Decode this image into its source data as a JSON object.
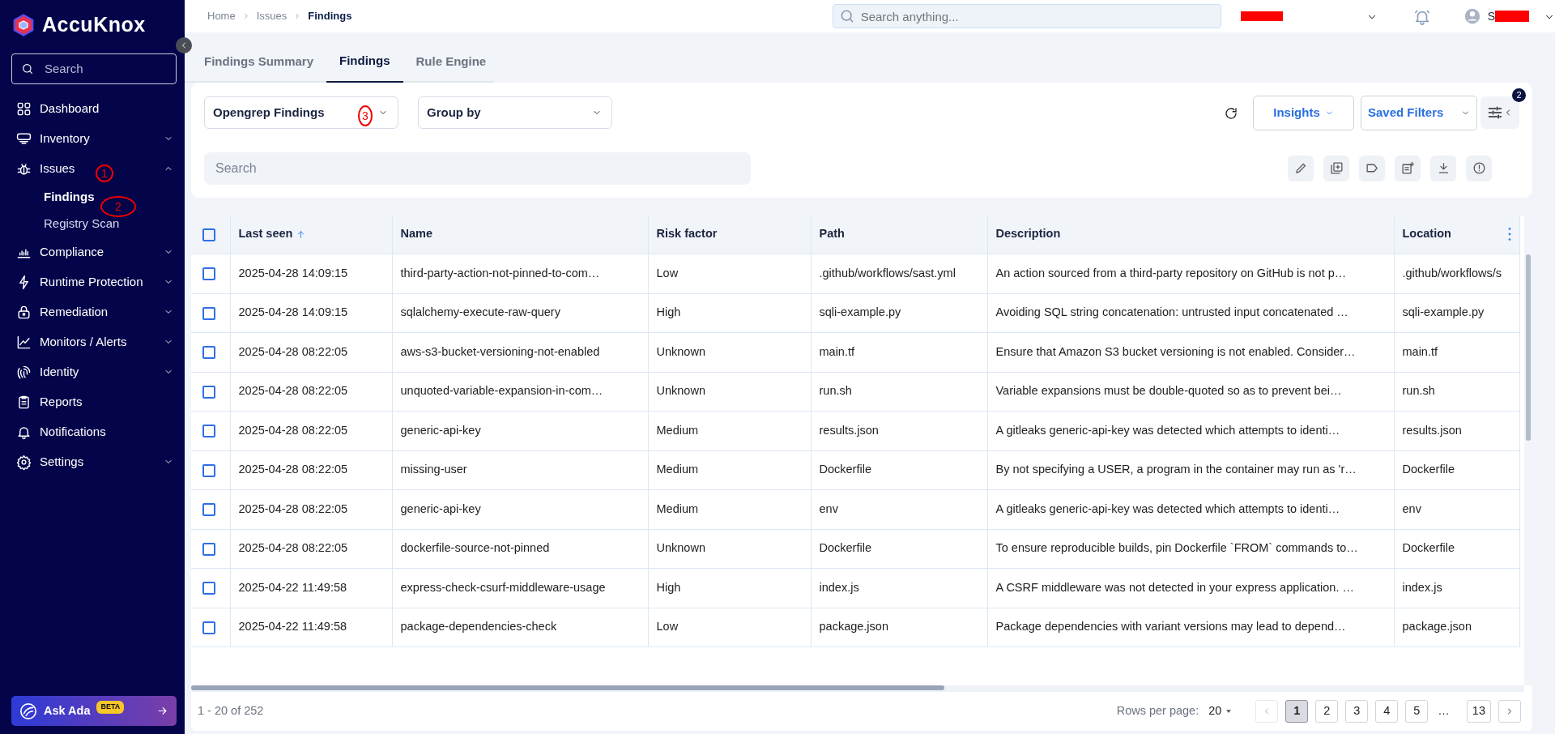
{
  "sidebar": {
    "brand": "AccuKnox",
    "search_placeholder": "Search",
    "items": [
      {
        "label": "Dashboard",
        "expandable": false
      },
      {
        "label": "Inventory",
        "expandable": true,
        "expanded": false
      },
      {
        "label": "Issues",
        "expandable": true,
        "expanded": true,
        "children": [
          {
            "label": "Findings",
            "selected": true
          },
          {
            "label": "Registry Scan",
            "selected": false
          }
        ]
      },
      {
        "label": "Compliance",
        "expandable": true,
        "expanded": false
      },
      {
        "label": "Runtime Protection",
        "expandable": true,
        "expanded": false
      },
      {
        "label": "Remediation",
        "expandable": true,
        "expanded": false
      },
      {
        "label": "Monitors / Alerts",
        "expandable": true,
        "expanded": false
      },
      {
        "label": "Identity",
        "expandable": true,
        "expanded": false
      },
      {
        "label": "Reports",
        "expandable": false
      },
      {
        "label": "Notifications",
        "expandable": false
      },
      {
        "label": "Settings",
        "expandable": true,
        "expanded": false
      }
    ],
    "assistant": {
      "label": "Ask Ada",
      "badge": "BETA"
    }
  },
  "breadcrumb": [
    "Home",
    "Issues",
    "Findings"
  ],
  "global_search": {
    "placeholder": "Search anything..."
  },
  "user": {
    "name_visible": "S"
  },
  "tabs": [
    {
      "label": "Findings Summary",
      "selected": false
    },
    {
      "label": "Findings",
      "selected": true
    },
    {
      "label": "Rule Engine",
      "selected": false
    }
  ],
  "filters": {
    "source": "Opengrep Findings",
    "group_by": "Group by",
    "insights": "Insights",
    "saved_filters": "Saved Filters",
    "filter_count": "2",
    "search_placeholder": "Search"
  },
  "annotations": [
    "1",
    "2",
    "3"
  ],
  "table": {
    "select_all_checked": false,
    "columns": [
      "Last seen",
      "Name",
      "Risk factor",
      "Path",
      "Description",
      "Location"
    ],
    "rows": [
      {
        "checked": false,
        "cells": [
          "2025-04-28 14:09:15",
          "third-party-action-not-pinned-to-com…",
          "Low",
          ".github/workflows/sast.yml",
          "An action sourced from a third-party repository on GitHub is not p…",
          ".github/workflows/s"
        ]
      },
      {
        "checked": false,
        "cells": [
          "2025-04-28 14:09:15",
          "sqlalchemy-execute-raw-query",
          "High",
          "sqli-example.py",
          "Avoiding SQL string concatenation: untrusted input concatenated …",
          "sqli-example.py"
        ]
      },
      {
        "checked": false,
        "cells": [
          "2025-04-28 08:22:05",
          "aws-s3-bucket-versioning-not-enabled",
          "Unknown",
          "main.tf",
          "Ensure that Amazon S3 bucket versioning is not enabled. Consider…",
          "main.tf"
        ]
      },
      {
        "checked": false,
        "cells": [
          "2025-04-28 08:22:05",
          "unquoted-variable-expansion-in-com…",
          "Unknown",
          "run.sh",
          "Variable expansions must be double-quoted so as to prevent bei…",
          "run.sh"
        ]
      },
      {
        "checked": false,
        "cells": [
          "2025-04-28 08:22:05",
          "generic-api-key",
          "Medium",
          "results.json",
          "A gitleaks generic-api-key was detected which attempts to identi…",
          "results.json"
        ]
      },
      {
        "checked": false,
        "cells": [
          "2025-04-28 08:22:05",
          "missing-user",
          "Medium",
          "Dockerfile",
          "By not specifying a USER, a program in the container may run as 'r…",
          "Dockerfile"
        ]
      },
      {
        "checked": false,
        "cells": [
          "2025-04-28 08:22:05",
          "generic-api-key",
          "Medium",
          "env",
          "A gitleaks generic-api-key was detected which attempts to identi…",
          "env"
        ]
      },
      {
        "checked": false,
        "cells": [
          "2025-04-28 08:22:05",
          "dockerfile-source-not-pinned",
          "Unknown",
          "Dockerfile",
          "To ensure reproducible builds, pin Dockerfile `FROM` commands to…",
          "Dockerfile"
        ]
      },
      {
        "checked": false,
        "cells": [
          "2025-04-22 11:49:58",
          "express-check-csurf-middleware-usage",
          "High",
          "index.js",
          "A CSRF middleware was not detected in your express application. …",
          "index.js"
        ]
      },
      {
        "checked": false,
        "cells": [
          "2025-04-22 11:49:58",
          "package-dependencies-check",
          "Low",
          "package.json",
          "Package dependencies with variant versions may lead to depend…",
          "package.json"
        ]
      }
    ]
  },
  "footer": {
    "range": "1 - 20 of 252",
    "rows_per_page_label": "Rows per page:",
    "rows_per_page": "20",
    "pages": [
      {
        "label": "1",
        "selected": true
      },
      {
        "label": "2",
        "selected": false
      },
      {
        "label": "3",
        "selected": false
      },
      {
        "label": "4",
        "selected": false
      },
      {
        "label": "5",
        "selected": false
      },
      {
        "label": "…",
        "kind": "gap"
      },
      {
        "label": "13",
        "selected": false
      }
    ],
    "prev_disabled": true,
    "next_disabled": false
  }
}
